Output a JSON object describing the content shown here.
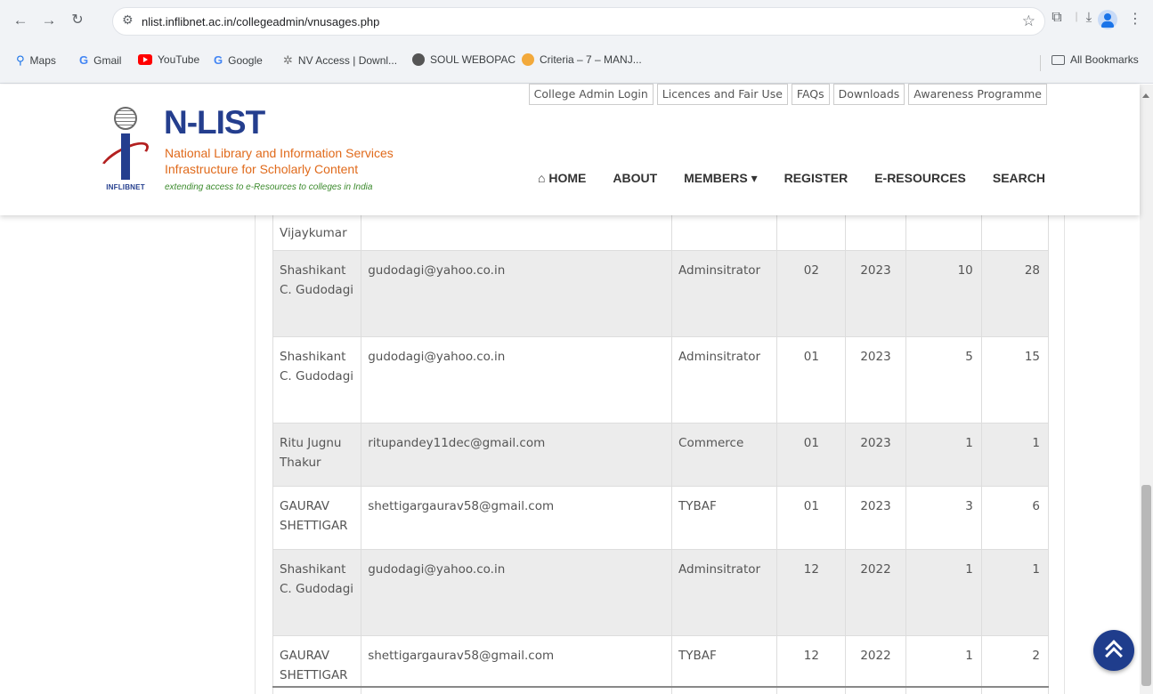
{
  "browser": {
    "url": "nlist.inflibnet.ac.in/collegeadmin/vnusages.php",
    "bookmarks": [
      "Maps",
      "Gmail",
      "YouTube",
      "Google",
      "NV Access | Downl...",
      "SOUL WEBOPAC",
      "Criteria – 7 – MANJ..."
    ],
    "all_bookmarks": "All Bookmarks",
    "icons": [
      "back-arrow-icon",
      "forward-arrow-icon",
      "reload-icon",
      "star-icon",
      "extensions-icon",
      "download-icon",
      "sidepanel-icon",
      "profile-icon",
      "menu-icon"
    ]
  },
  "header": {
    "logo_word": "INFLIBNET",
    "title": "N-LIST",
    "subtitle1": "National Library and Information Services",
    "subtitle2": "Infrastructure for Scholarly Content",
    "tagline": "extending access to e-Resources to colleges in India",
    "top_links": [
      "College Admin Login",
      "Licences and Fair Use",
      "FAQs",
      "Downloads",
      "Awareness Programme"
    ],
    "nav": [
      "HOME",
      "ABOUT",
      "MEMBERS",
      "REGISTER",
      "E-RESOURCES",
      "SEARCH"
    ]
  },
  "table": {
    "partial_row": [
      "Vijaykumar",
      "",
      "",
      "",
      "",
      "",
      ""
    ],
    "rows": [
      [
        "Shashikant C. Gudodagi",
        "gudodagi@yahoo.co.in",
        "Adminsitrator",
        "02",
        "2023",
        "10",
        "28"
      ],
      [
        "Shashikant C. Gudodagi",
        "gudodagi@yahoo.co.in",
        "Adminsitrator",
        "01",
        "2023",
        "5",
        "15"
      ],
      [
        "Ritu Jugnu Thakur",
        "ritupandey11dec@gmail.com",
        "Commerce",
        "01",
        "2023",
        "1",
        "1"
      ],
      [
        "GAURAV SHETTIGAR",
        "shettigargaurav58@gmail.com",
        "TYBAF",
        "01",
        "2023",
        "3",
        "6"
      ],
      [
        "Shashikant C. Gudodagi",
        "gudodagi@yahoo.co.in",
        "Adminsitrator",
        "12",
        "2022",
        "1",
        "1"
      ],
      [
        "GAURAV SHETTIGAR",
        "shettigargaurav58@gmail.com",
        "TYBAF",
        "12",
        "2022",
        "1",
        "2"
      ]
    ]
  },
  "colors": {
    "brand_blue": "#243e8e",
    "brand_orange": "#e06a1b",
    "row_shade": "#ececec",
    "back_to_top": "#1f3d8c"
  }
}
